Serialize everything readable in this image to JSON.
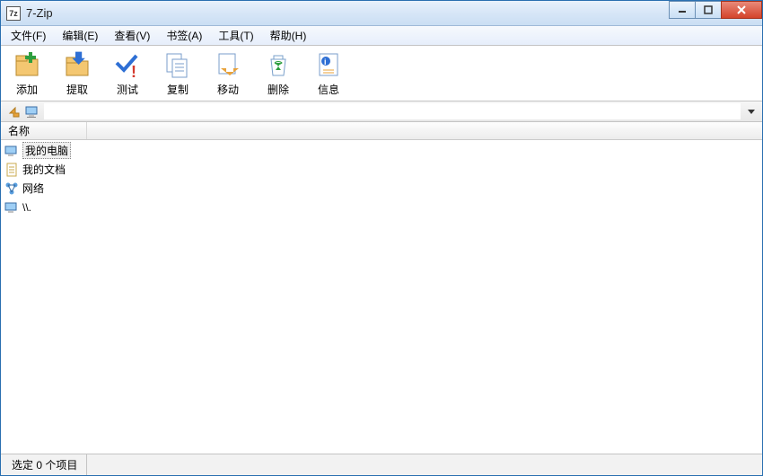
{
  "window": {
    "title": "7-Zip",
    "app_icon_text": "7z"
  },
  "menu": {
    "file": "文件(F)",
    "edit": "编辑(E)",
    "view": "查看(V)",
    "bookmarks": "书签(A)",
    "tools": "工具(T)",
    "help": "帮助(H)"
  },
  "toolbar": {
    "add": "添加",
    "extract": "提取",
    "test": "测试",
    "copy": "复制",
    "move": "移动",
    "delete": "删除",
    "info": "信息"
  },
  "columns": {
    "name": "名称"
  },
  "items": [
    {
      "label": "我的电脑",
      "icon": "computer",
      "selected": true
    },
    {
      "label": "我的文档",
      "icon": "document",
      "selected": false
    },
    {
      "label": "网络",
      "icon": "network",
      "selected": false
    },
    {
      "label": "\\\\.",
      "icon": "computer-small",
      "selected": false
    }
  ],
  "status": {
    "selection": "选定 0 个项目"
  }
}
